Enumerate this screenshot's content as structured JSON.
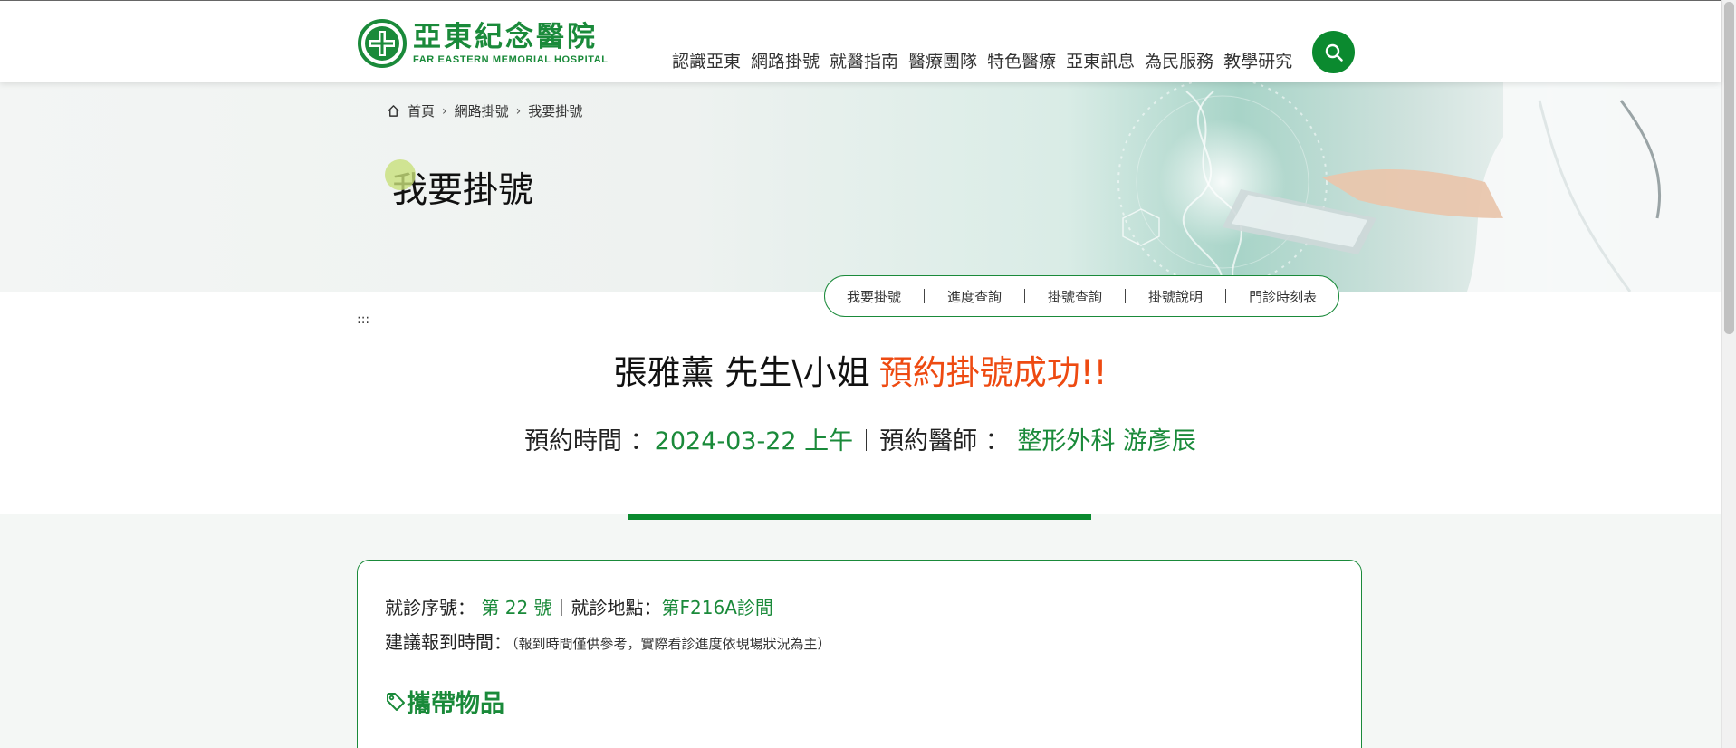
{
  "header": {
    "logo_cn": "亞東紀念醫院",
    "logo_en": "FAR EASTERN MEMORIAL HOSPITAL",
    "nav": [
      "認識亞東",
      "網路掛號",
      "就醫指南",
      "醫療團隊",
      "特色醫療",
      "亞東訊息",
      "為民服務",
      "教學研究"
    ],
    "search_icon": "search-icon"
  },
  "breadcrumb": {
    "home": "首頁",
    "level1": "網路掛號",
    "level2": "我要掛號",
    "home_icon": "home-icon",
    "sep_icon": "chevron-right-icon"
  },
  "page_title": "我要掛號",
  "subtabs": [
    "我要掛號",
    "進度查詢",
    "掛號查詢",
    "掛號說明",
    "門診時刻表"
  ],
  "anchor_text": ":::",
  "result": {
    "name": "張雅薰 先生\\小姐",
    "status": "預約掛號成功!!",
    "time_label": "預約時間 ：",
    "time_value": "2024-03-22 上午",
    "doctor_label": "預約醫師 ：",
    "doctor_value": "整形外科 游彥辰"
  },
  "card": {
    "seq_label": "就診序號：",
    "seq_value": "第 22 號",
    "place_label": "就診地點：",
    "place_value": "第F216A診間",
    "report_label": "建議報到時間：",
    "report_note": "（報到時間僅供參考，實際看診進度依現場狀況為主）",
    "items_title": "攜帶物品",
    "items_icon": "tag-icon"
  },
  "colors": {
    "brand_green": "#1a8a3a",
    "success_orange": "#ee4a11",
    "progress_green": "#0b8a2f"
  }
}
